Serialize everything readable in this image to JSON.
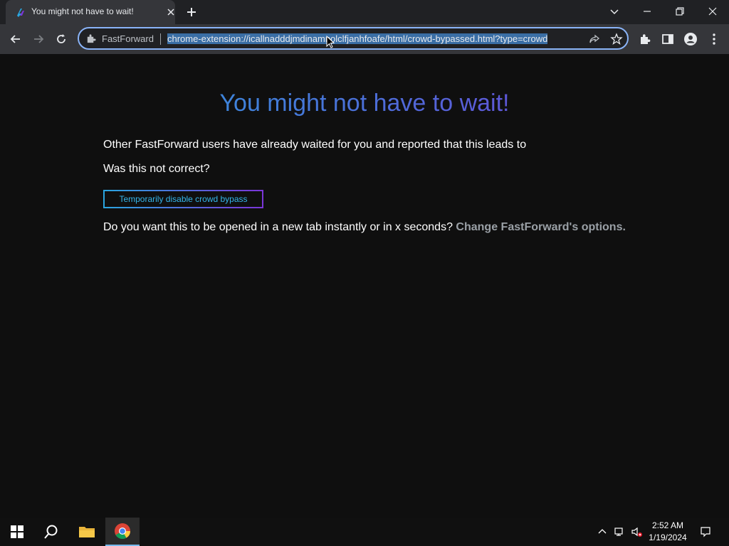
{
  "browser": {
    "tab_title": "You might not have to wait!",
    "extension_name": "FastForward",
    "url": "chrome-extension://icallnadddjmdinamnolclfjanhfoafe/html/crowd-bypassed.html?type=crowd"
  },
  "page": {
    "headline": "You might not have to wait!",
    "intro": "Other FastForward users have already waited for you and reported that this leads to",
    "question": "Was this not correct?",
    "disable_button": "Temporarily disable crowd bypass",
    "options_prompt": "Do you want this to be opened in a new tab instantly or in x seconds?",
    "options_link": "Change FastForward's options."
  },
  "taskbar": {
    "time": "2:52 AM",
    "date": "1/19/2024"
  },
  "colors": {
    "accent_blue": "#2aa5e0",
    "accent_purple": "#7a35d8"
  }
}
